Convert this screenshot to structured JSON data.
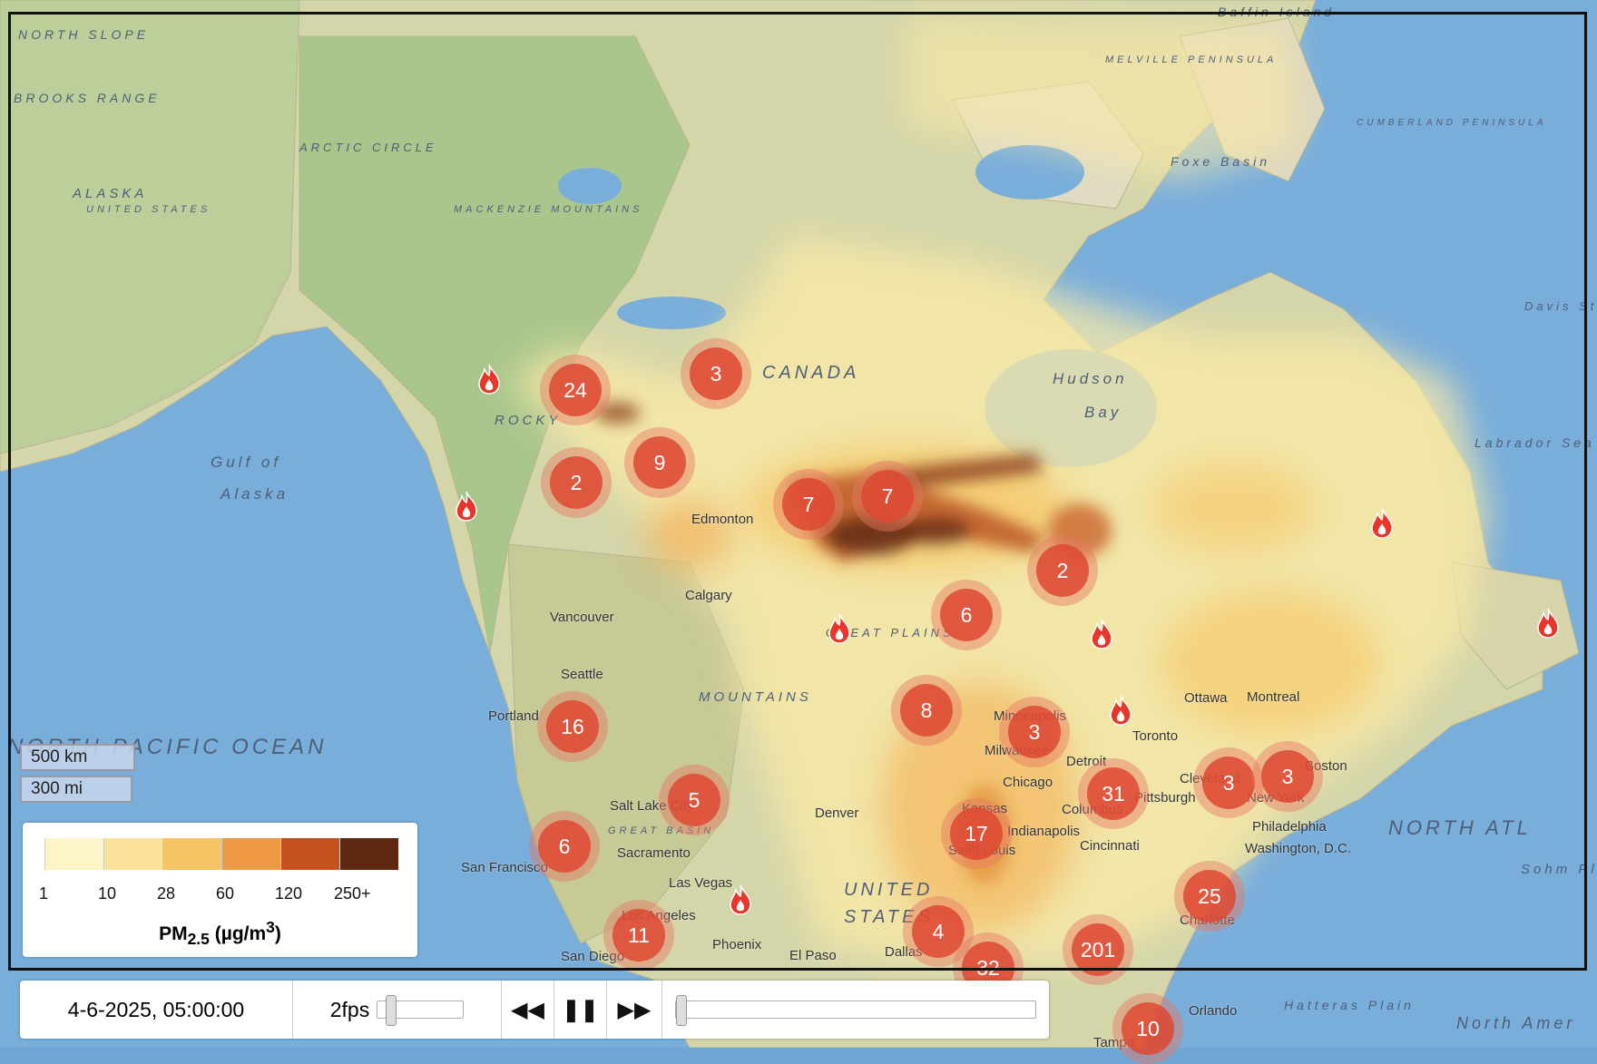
{
  "map": {
    "regions": [
      "NORTH SLOPE",
      "BROOKS RANGE",
      "ARCTIC CIRCLE",
      "ALASKA",
      "UNITED STATES",
      "CANADA",
      "Hudson",
      "Bay",
      "Foxe Basin",
      "Gulf of",
      "Alaska",
      "NORTH PACIFIC OCEAN",
      "NORTH ATL",
      "Labrador Sea",
      "Davis Strait",
      "ROCKY",
      "MOUNTAINS",
      "GREAT PLAINS",
      "UNITED",
      "STATES",
      "Hatteras Plain",
      "North Amer",
      "Sohm Pl",
      "Baffin Island",
      "MACKENZIE MOUNTAINS",
      "GREAT BASIN",
      "MELVILLE PENINSULA",
      "CUMBERLAND PENINSULA"
    ],
    "places": [
      "Edmonton",
      "Calgary",
      "Vancouver",
      "Seattle",
      "Portland",
      "Salt Lake City",
      "Sacramento",
      "San Francisco",
      "Las Vegas",
      "Los Angeles",
      "Phoenix",
      "San Diego",
      "El Paso",
      "Dallas",
      "Denver",
      "Minneapolis",
      "Milwaukee",
      "Chicago",
      "Detroit",
      "Toronto",
      "Ottawa",
      "Montreal",
      "Cleveland",
      "Pittsburgh",
      "Columbus",
      "Kansas",
      "Indianapolis",
      "Saint Louis",
      "Cincinnati",
      "Philadelphia",
      "Washington, D.C.",
      "New York",
      "Boston",
      "Charlotte",
      "Orlando",
      "Tampa"
    ],
    "clusters": [
      "24",
      "3",
      "9",
      "2",
      "7",
      "7",
      "2",
      "6",
      "8",
      "3",
      "16",
      "5",
      "31",
      "3",
      "3",
      "6",
      "17",
      "25",
      "11",
      "4",
      "32",
      "201",
      "10"
    ],
    "fire_icon": "fire-icon",
    "colors": {
      "ocean": "#79aedb",
      "land": "#dcd8b4",
      "cluster": "#de4832"
    }
  },
  "scale": {
    "km": "500 km",
    "mi": "300 mi"
  },
  "legend": {
    "colors": [
      "#fdf5c8",
      "#fbe29a",
      "#f6c463",
      "#ee9a45",
      "#c4521f",
      "#5e2811"
    ],
    "ticks": [
      "1",
      "10",
      "28",
      "60",
      "120",
      "250+"
    ],
    "title_main": "PM",
    "title_sub": "2.5",
    "title_unit": " (µg/m",
    "title_sup": "3",
    "title_end": ")"
  },
  "controls": {
    "datetime": "4-6-2025, 05:00:00",
    "fps": "2fps",
    "fps_slider": 0.1,
    "time_progress": 0.0,
    "rewind_icon": "rewind-icon",
    "pause_icon": "pause-icon",
    "forward_icon": "fast-forward-icon"
  }
}
